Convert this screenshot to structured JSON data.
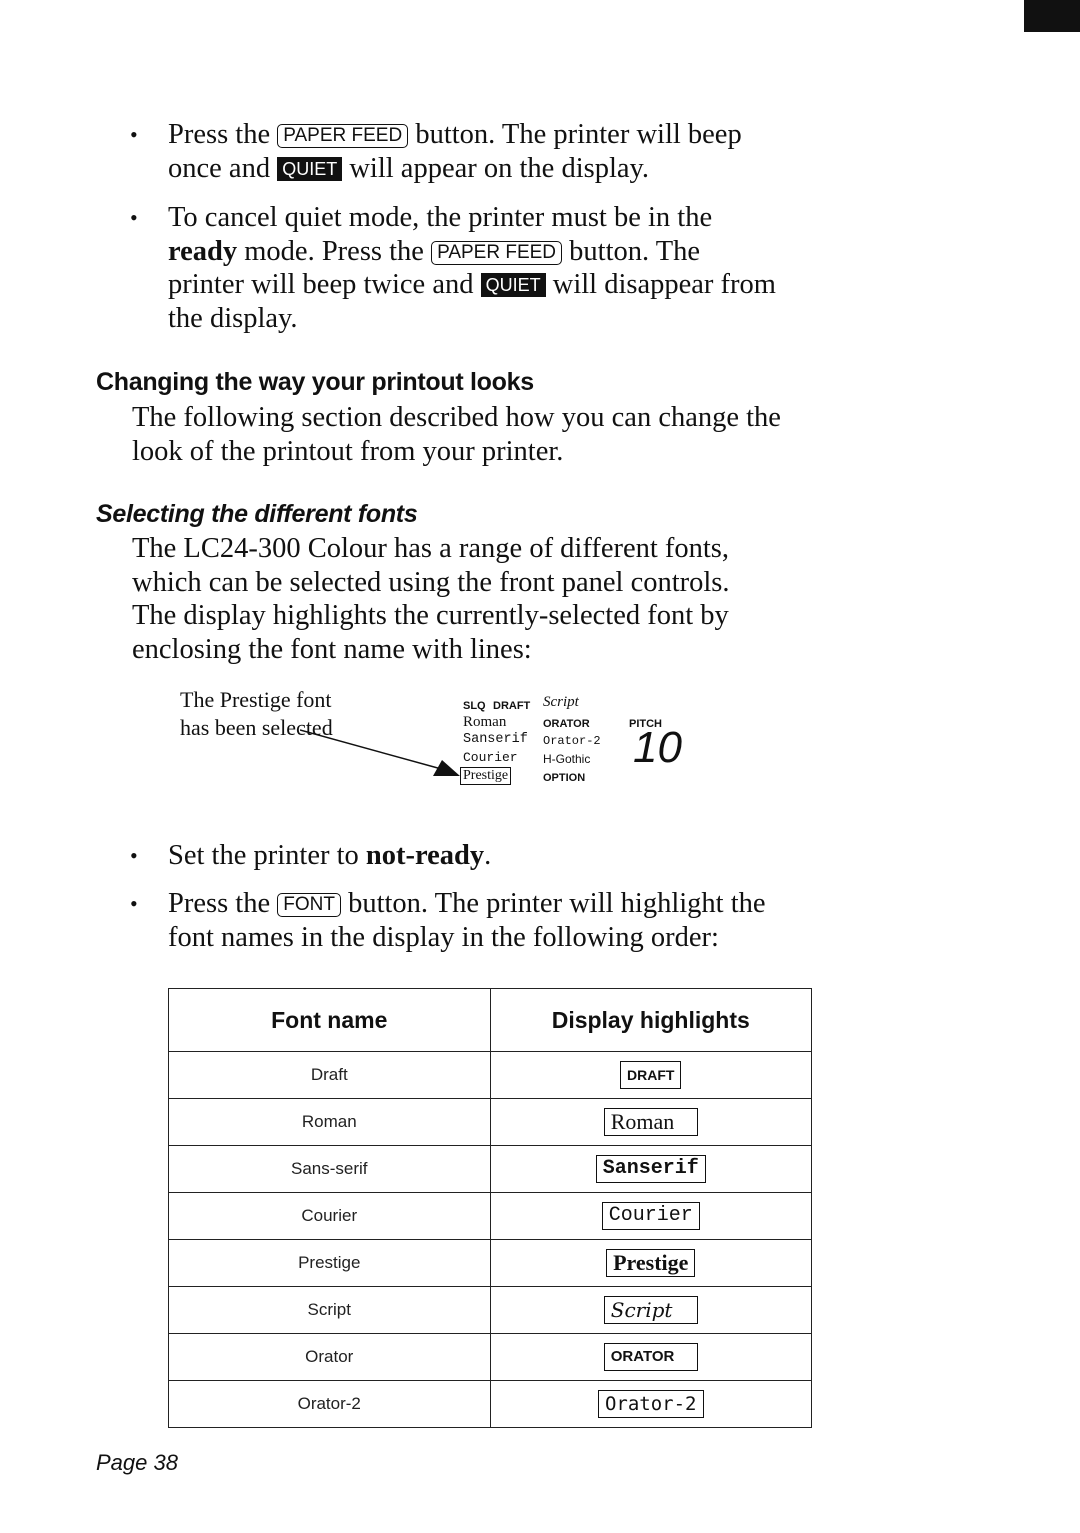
{
  "bullets_top": [
    {
      "parts": {
        "a": "Press the",
        "key": "PAPER FEED",
        "b": "button. The printer will beep",
        "c": "once and",
        "badge": "QUIET",
        "d": "will appear on the display."
      }
    },
    {
      "parts": {
        "a": "To cancel quiet mode, the printer must be in the",
        "bold": "ready",
        "b": "mode. Press the",
        "key": "PAPER FEED",
        "c": "button. The",
        "d": "printer will beep twice and",
        "badge": "QUIET",
        "e": "will disappear from",
        "f": "the display."
      }
    }
  ],
  "section": {
    "heading": "Changing the way your printout looks",
    "intro_line1": "The following section described how you can change the",
    "intro_line2": "look of the printout from your printer."
  },
  "subsection": {
    "heading": "Selecting the different fonts",
    "lines": [
      "The LC24-300 Colour has a range of different fonts,",
      "which can be selected using the front panel controls.",
      "The display highlights the currently-selected font by",
      "enclosing the font name with lines:"
    ]
  },
  "figure": {
    "caption_line1": "The Prestige font",
    "caption_line2": "has been selected",
    "lcd": {
      "slq": "SLQ",
      "draft": "DRAFT",
      "script": "Script",
      "roman": "Roman",
      "orator": "ORATOR",
      "pitch_label": "PITCH",
      "sanserif": "Sanserif",
      "orator2": "Orator-2",
      "pitch_value": "10",
      "courier": "Courier",
      "hgothic": "H-Gothic",
      "prestige": "Prestige",
      "option": "OPTION",
      "selected": "Prestige"
    }
  },
  "bullets_bottom": [
    {
      "a": "Set the printer to",
      "bold": "not-ready",
      "b": "."
    },
    {
      "a": "Press the",
      "key": "FONT",
      "b": "button. The printer will highlight the",
      "c": "font names in the display in the following order:"
    }
  ],
  "table": {
    "headers": [
      "Font name",
      "Display highlights"
    ],
    "rows": [
      {
        "name": "Draft",
        "display": "DRAFT"
      },
      {
        "name": "Roman",
        "display": "Roman"
      },
      {
        "name": "Sans-serif",
        "display": "Sanserif"
      },
      {
        "name": "Courier",
        "display": "Courier"
      },
      {
        "name": "Prestige",
        "display": "Prestige"
      },
      {
        "name": "Script",
        "display": "Script"
      },
      {
        "name": "Orator",
        "display": "ORATOR"
      },
      {
        "name": "Orator-2",
        "display": "Orator-2"
      }
    ]
  },
  "footer": {
    "page_label": "Page 38"
  }
}
